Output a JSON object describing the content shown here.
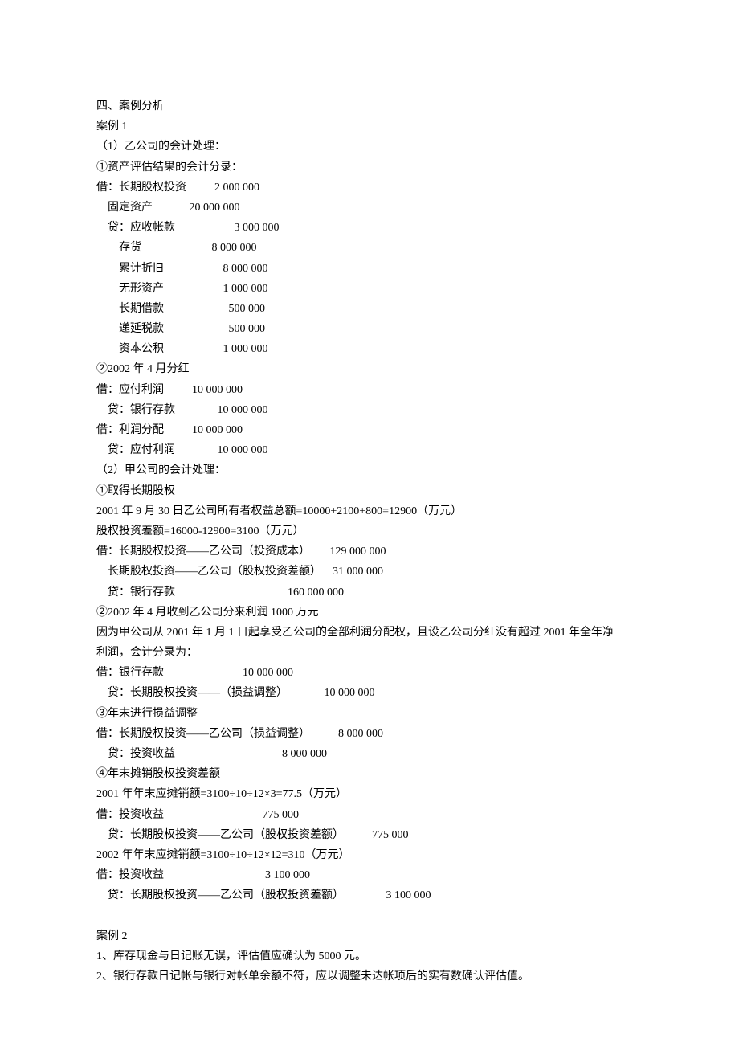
{
  "lines": [
    "四、案例分析",
    "案例 1",
    "（1）乙公司的会计处理：",
    "①资产评估结果的会计分录：",
    "借：长期股权投资          2 000 000",
    "    固定资产             20 000 000",
    "    贷：应收帐款                     3 000 000",
    "        存货                         8 000 000",
    "        累计折旧                     8 000 000",
    "        无形资产                     1 000 000",
    "        长期借款                       500 000",
    "        递延税款                       500 000",
    "        资本公积                     1 000 000",
    "②2002 年 4 月分红",
    "借：应付利润          10 000 000",
    "    贷：银行存款               10 000 000",
    "借：利润分配          10 000 000",
    "    贷：应付利润               10 000 000",
    "（2）甲公司的会计处理：",
    "①取得长期股权",
    "2001 年 9 月 30 日乙公司所有者权益总额=10000+2100+800=12900（万元）",
    "股权投资差额=16000-12900=3100（万元）",
    "借：长期股权投资——乙公司（投资成本）       129 000 000",
    "    长期股权投资——乙公司（股权投资差额）    31 000 000",
    "    贷：银行存款                                        160 000 000",
    "②2002 年 4 月收到乙公司分来利润 1000 万元",
    "因为甲公司从 2001 年 1 月 1 日起享受乙公司的全部利润分配权，且设乙公司分红没有超过 2001 年全年净",
    "利润，会计分录为：",
    "借：银行存款                            10 000 000",
    "    贷：长期股权投资——（损益调整）             10 000 000",
    "③年末进行损益调整",
    "借：长期股权投资——乙公司（损益调整）          8 000 000",
    "    贷：投资收益                                      8 000 000",
    "④年末摊销股权投资差额",
    "2001 年年末应摊销额=3100÷10÷12×3=77.5（万元）",
    "借：投资收益                                   775 000",
    "    贷：长期股权投资——乙公司（股权投资差额）          775 000",
    "2002 年年末应摊销额=3100÷10÷12×12=310（万元）",
    "借：投资收益                                    3 100 000",
    "    贷：长期股权投资——乙公司（股权投资差额）               3 100 000",
    "",
    "案例 2",
    "1、库存现金与日记账无误，评估值应确认为 5000 元。",
    "2、银行存款日记帐与银行对帐单余额不符，应以调整未达帐项后的实有数确认评估值。"
  ]
}
